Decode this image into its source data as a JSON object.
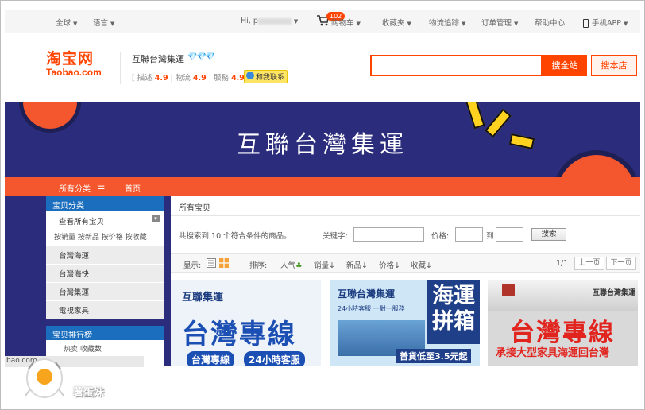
{
  "topbar": {
    "region": "全球",
    "language": "语言",
    "greeting": "Hi, p",
    "cart_badge": "102",
    "cart": "购物车",
    "favorites": "收藏夹",
    "logistics": "物流追踪",
    "orders": "订单管理",
    "help": "帮助中心",
    "mobile": "手机APP"
  },
  "header": {
    "logo_cn": "淘宝网",
    "logo_en": "Taobao.com",
    "shop_name": "互聯台灣集運",
    "diamonds": "💎💎💎",
    "rating_desc_label": "描述",
    "rating_desc": "4.9",
    "rating_logistics_label": "物流",
    "rating_logistics": "4.9",
    "rating_service_label": "服務",
    "rating_service": "4.9",
    "contact": "和我联系",
    "search_placeholder": "",
    "search_all": "搜全站",
    "search_shop": "搜本店"
  },
  "banner": {
    "title": "互聯台灣集運"
  },
  "nav": {
    "all_categories": "所有分类",
    "all_categories_icon": "menu-icon",
    "home": "首页"
  },
  "sidebar": {
    "title": "宝贝分类",
    "view_all": "查看所有宝贝",
    "sort_links": "按销量 按新品 按价格 按收藏",
    "categories": [
      "台灣海運",
      "台灣海快",
      "台灣集運",
      "電視家具"
    ],
    "ranking_title": "宝贝排行榜",
    "ranking_tabs": "热卖 收藏数"
  },
  "main": {
    "breadcrumb": "所有宝贝",
    "result_text": "共搜索到 10 个符合条件的商品。",
    "keyword_label": "关键字:",
    "price_label": "价格:",
    "to_label": "到",
    "search_btn": "搜索",
    "display_label": "显示:",
    "sort_label": "排序:",
    "sort_options": [
      "人气",
      "销量",
      "新品",
      "价格",
      "收藏"
    ],
    "page_info": "1/1",
    "prev_page": "上一页",
    "next_page": "下一页"
  },
  "products": [
    {
      "brand": "互聯集運",
      "big": "台灣專線",
      "tags": [
        "台灣專線",
        "24小時客服"
      ]
    },
    {
      "brand": "互聯台灣集運",
      "sub": "24小時客服 一對一服務",
      "big": "海運拼箱",
      "price": "普貨低至3.5元起"
    },
    {
      "brand": "互聯台灣集運",
      "big": "台灣專線",
      "sub": "承接大型家具海運回台灣"
    }
  ],
  "overlay": {
    "url": "bao.com",
    "watermark": "薯蛋妹"
  },
  "colors": {
    "accent": "#ff4400",
    "banner": "#2b2d7c",
    "nav": "#f4572d",
    "sidebar_head": "#1b6ebd"
  }
}
